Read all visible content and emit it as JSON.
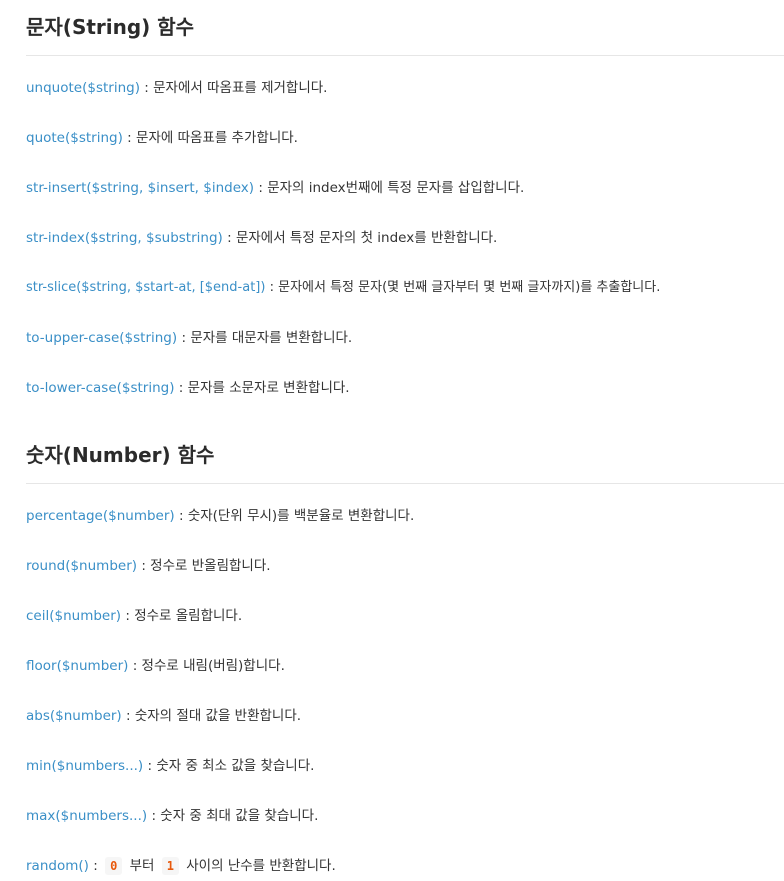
{
  "sections": [
    {
      "title": "문자(String) 함수",
      "items": [
        {
          "fn": "unquote($string)",
          "desc": "문자에서 따옴표를 제거합니다."
        },
        {
          "fn": "quote($string)",
          "desc": "문자에 따옴표를 추가합니다."
        },
        {
          "fn": "str-insert($string, $insert, $index)",
          "desc": "문자의 index번째에 특정 문자를 삽입합니다."
        },
        {
          "fn": "str-index($string, $substring)",
          "desc": "문자에서 특정 문자의 첫 index를 반환합니다."
        },
        {
          "fn": "str-slice($string, $start-at, [$end-at])",
          "desc": "문자에서 특정 문자(몇 번째 글자부터 몇 번째 글자까지)를 추출합니다."
        },
        {
          "fn": "to-upper-case($string)",
          "desc": "문자를 대문자를 변환합니다."
        },
        {
          "fn": "to-lower-case($string)",
          "desc": "문자를 소문자로 변환합니다."
        }
      ]
    },
    {
      "title": "숫자(Number) 함수",
      "items": [
        {
          "fn": "percentage($number)",
          "desc": "숫자(단위 무시)를 백분율로 변환합니다."
        },
        {
          "fn": "round($number)",
          "desc": "정수로 반올림합니다."
        },
        {
          "fn": "ceil($number)",
          "desc": "정수로 올림합니다."
        },
        {
          "fn": "floor($number)",
          "desc": "정수로 내림(버림)합니다."
        },
        {
          "fn": "abs($number)",
          "desc": "숫자의 절대 값을 반환합니다."
        },
        {
          "fn": "min($numbers...)",
          "desc": "숫자 중 최소 값을 찾습니다."
        },
        {
          "fn": "max($numbers...)",
          "desc": "숫자 중 최대 값을 찾습니다."
        }
      ],
      "random": {
        "fn": "random()",
        "code1": "0",
        "text1": "부터",
        "code2": "1",
        "text2": "사이의 난수를 반환합니다."
      }
    }
  ],
  "separator": ":"
}
